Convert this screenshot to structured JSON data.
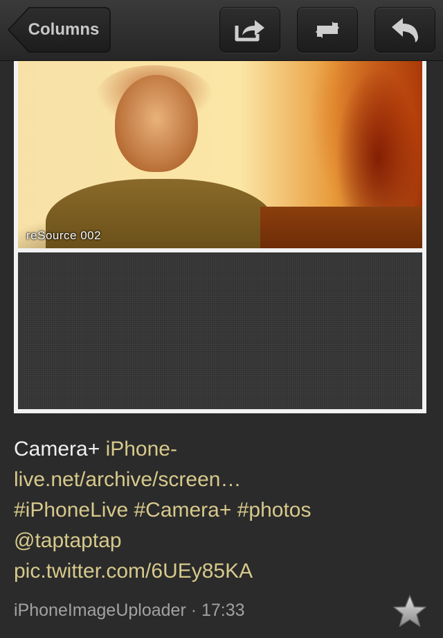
{
  "nav": {
    "back_label": "Columns",
    "buttons": [
      {
        "name": "share-button",
        "icon": "share-icon"
      },
      {
        "name": "retweet-button",
        "icon": "retweet-icon"
      },
      {
        "name": "reply-button",
        "icon": "reply-icon"
      }
    ]
  },
  "photo": {
    "caption": "reSource 002"
  },
  "tweet": {
    "text_lead": "Camera+ ",
    "link1_line1": "iPhone-",
    "link1_line2": "live.net/archive/screen…",
    "hashtags": "#iPhoneLive #Camera+ #photos",
    "mention": "@taptaptap",
    "pic_link": "pic.twitter.com/6UEy85KA"
  },
  "meta": {
    "source": "iPhoneImageUploader",
    "separator": " · ",
    "time": "17:33",
    "favorite_icon": "star-icon"
  },
  "colors": {
    "background": "#2b2b2b",
    "link": "#d7c98c",
    "text": "#f0f0f0",
    "meta": "#a2a2a2"
  }
}
